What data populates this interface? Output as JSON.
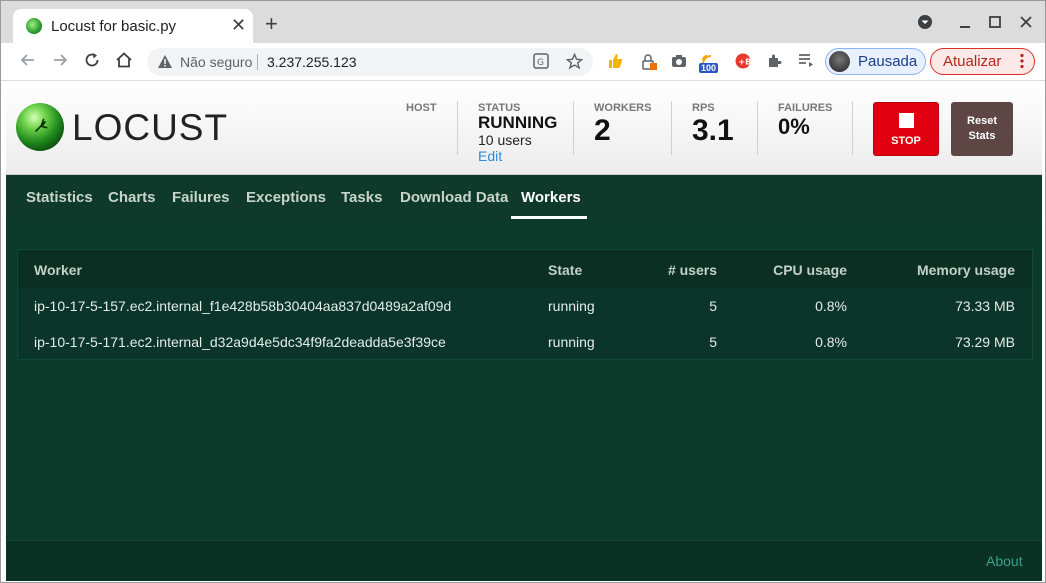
{
  "browser": {
    "tab_title": "Locust for basic.py",
    "tab_close": "✕",
    "new_tab": "+",
    "address_insecure_label": "Não seguro",
    "address_url": "3.237.255.123",
    "profile_label": "Pausada",
    "update_label": "Atualizar",
    "ext_badge": "100",
    "icons": [
      "back-arrow-icon",
      "forward-arrow-icon",
      "reload-icon",
      "home-icon",
      "warning-icon",
      "translate-icon",
      "star-icon",
      "thumbs-up-icon",
      "lock-icon",
      "camera-icon",
      "rss-icon",
      "extension-icon",
      "puzzle-icon",
      "playlist-icon"
    ]
  },
  "header": {
    "logo_text": "LOCUST",
    "host_label": "HOST",
    "status_label": "STATUS",
    "status_value": "RUNNING",
    "status_users": "10 users",
    "status_edit": "Edit",
    "workers_label": "WORKERS",
    "workers_value": "2",
    "rps_label": "RPS",
    "rps_value": "3.1",
    "failures_label": "FAILURES",
    "failures_value": "0%",
    "stop_label": "STOP",
    "reset_label_line1": "Reset",
    "reset_label_line2": "Stats",
    "colors": {
      "stop": "#e0000f",
      "reset": "#5e4644",
      "page_bg": "#0d3a2c"
    }
  },
  "nav": {
    "tabs": [
      {
        "label": "Statistics"
      },
      {
        "label": "Charts"
      },
      {
        "label": "Failures"
      },
      {
        "label": "Exceptions"
      },
      {
        "label": "Tasks"
      },
      {
        "label": "Download Data"
      },
      {
        "label": "Workers"
      }
    ],
    "active": "Workers"
  },
  "workers_table": {
    "columns": [
      "Worker",
      "State",
      "# users",
      "CPU usage",
      "Memory usage"
    ],
    "rows": [
      {
        "worker": "ip-10-17-5-157.ec2.internal_f1e428b58b30404aa837d0489a2af09d",
        "state": "running",
        "users": "5",
        "cpu": "0.8%",
        "memory": "73.33 MB"
      },
      {
        "worker": "ip-10-17-5-171.ec2.internal_d32a9d4e5dc34f9fa2deadda5e3f39ce",
        "state": "running",
        "users": "5",
        "cpu": "0.8%",
        "memory": "73.29 MB"
      }
    ]
  },
  "footer": {
    "about_label": "About"
  }
}
